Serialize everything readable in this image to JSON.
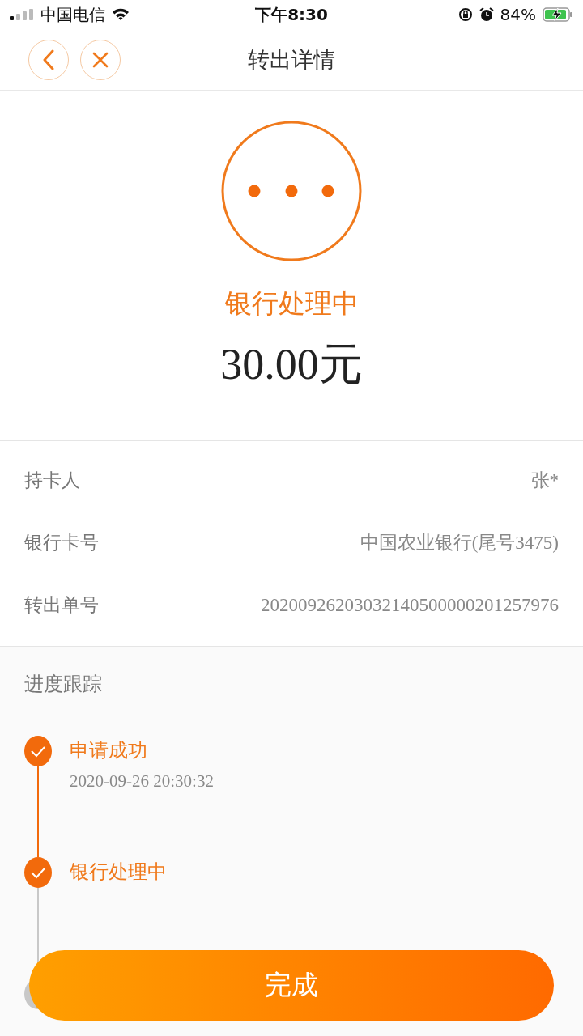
{
  "status_bar": {
    "carrier": "中国电信",
    "time": "下午8:30",
    "battery": "84%"
  },
  "nav": {
    "title": "转出详情"
  },
  "result": {
    "status": "银行处理中",
    "amount": "30.00元"
  },
  "details": [
    {
      "label": "持卡人",
      "value": "张*"
    },
    {
      "label": "银行卡号",
      "value": "中国农业银行(尾号3475)"
    },
    {
      "label": "转出单号",
      "value": "20200926203032140500000201257976"
    }
  ],
  "progress": {
    "title": "进度跟踪",
    "steps": [
      {
        "title": "申请成功",
        "time": "2020-09-26 20:30:32",
        "done": true
      },
      {
        "title": "银行处理中",
        "done": true
      },
      {
        "done": false
      }
    ]
  },
  "done_button": "完成"
}
